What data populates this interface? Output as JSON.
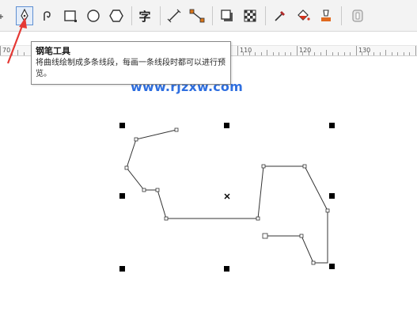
{
  "toolbar": {
    "tools": [
      {
        "name": "pen-tool-icon",
        "active": true
      },
      {
        "name": "spiral-curve-icon",
        "active": false
      },
      {
        "name": "rectangle-icon",
        "active": false
      },
      {
        "name": "ellipse-icon",
        "active": false
      },
      {
        "name": "polygon-icon",
        "active": false
      },
      {
        "name": "text-tool-icon",
        "active": false
      },
      {
        "name": "parallel-dimension-icon",
        "active": false
      },
      {
        "name": "connector-icon",
        "active": false
      },
      {
        "name": "drop-shadow-icon",
        "active": false
      },
      {
        "name": "transparency-icon",
        "active": false
      },
      {
        "name": "eyedropper-icon",
        "active": false
      },
      {
        "name": "interactive-fill-icon",
        "active": false
      },
      {
        "name": "smart-fill-icon",
        "active": false
      },
      {
        "name": "lock-icon",
        "active": false
      }
    ],
    "text_glyph": "字"
  },
  "ruler": {
    "labels": [
      "70",
      "110",
      "120",
      "130"
    ]
  },
  "tooltip": {
    "title": "钢笔工具",
    "description": "将曲线绘制成多条线段，每画一条线段时都可以进行预览。"
  },
  "watermark": "www.rjzxw.com",
  "colors": {
    "accent": "#5e8fd2",
    "annotation_arrow": "#e53935",
    "watermark": "#2f6fe0",
    "handle": "#000000"
  }
}
